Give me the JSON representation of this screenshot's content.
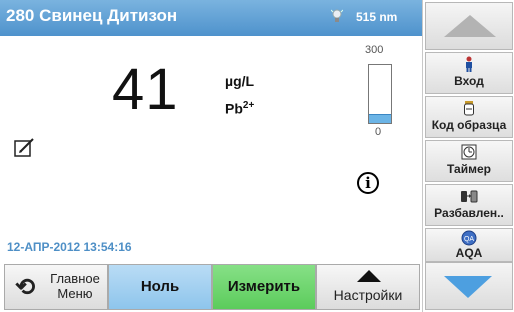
{
  "header": {
    "title": "280 Свинец Дитизон",
    "wavelength": "515 nm",
    "lamp_icon": "lamp-icon"
  },
  "reading": {
    "value": "41",
    "unit": "µg/L",
    "species_base": "Pb",
    "species_charge": "2+"
  },
  "range_bar": {
    "max_label": "300",
    "min_label": "0",
    "level_fraction": 0.137,
    "fill_color": "#6bb4e6"
  },
  "timestamp": "12-АПР-2012  13:54:16",
  "side_panel": {
    "items": [
      {
        "label": "Вход",
        "icon": "person-icon"
      },
      {
        "label": "Код образца",
        "icon": "sample-bottle-icon"
      },
      {
        "label": "Таймер",
        "icon": "timer-icon"
      },
      {
        "label": "Разбавлен..",
        "icon": "dilution-icon"
      },
      {
        "label": "AQA",
        "icon": "aqa-icon"
      }
    ],
    "scroll_up_icon": "scroll-up-icon",
    "scroll_down_icon": "scroll-down-icon"
  },
  "bottom_bar": {
    "back_label_line1": "Главное",
    "back_label_line2": "Меню",
    "zero_label": "Ноль",
    "measure_label": "Измерить",
    "settings_label": "Настройки"
  },
  "colors": {
    "header": "#5d9fd4",
    "zero_button": "#a6d2f1",
    "measure_button": "#71d671",
    "timestamp": "#4e8fc6"
  }
}
